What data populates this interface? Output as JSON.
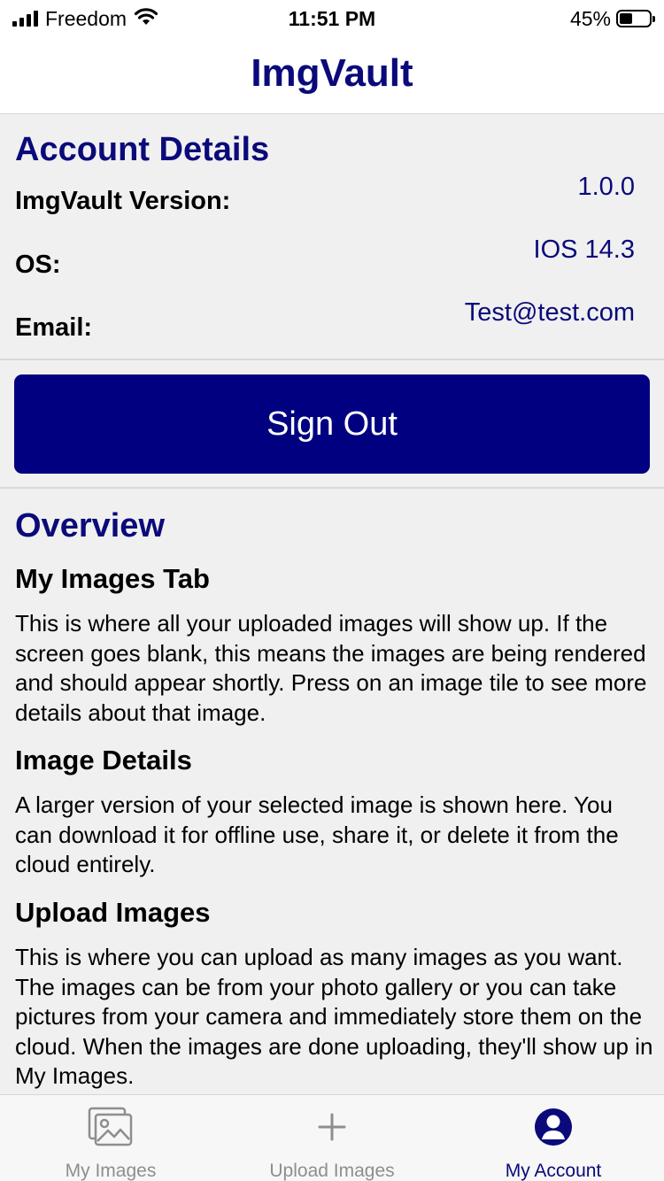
{
  "status_bar": {
    "carrier": "Freedom",
    "time": "11:51 PM",
    "battery_percent": "45%",
    "battery_level": 0.45
  },
  "header": {
    "title": "ImgVault"
  },
  "account": {
    "title": "Account Details",
    "version_label": "ImgVault Version:",
    "version_value": "1.0.0",
    "os_label": "OS:",
    "os_value": "IOS 14.3",
    "email_label": "Email:",
    "email_value": "Test@test.com"
  },
  "sign_out_label": "Sign Out",
  "overview": {
    "title": "Overview",
    "sections": [
      {
        "heading": "My Images Tab",
        "body": "This is where all your uploaded images will show up. If the screen goes blank, this means the images are being rendered and should appear shortly. Press on an image tile to see more details about that image."
      },
      {
        "heading": "Image Details",
        "body": "A larger version of your selected image is shown here. You can download it for offline use, share it, or delete it from the cloud entirely."
      },
      {
        "heading": "Upload Images",
        "body": "This is where you can upload as many images as you want. The images can be from your photo gallery or you can take pictures from your camera and immediately store them on the cloud. When the images are done uploading, they'll show up in My Images."
      }
    ]
  },
  "tabs": [
    {
      "label": "My Images",
      "icon": "images-icon",
      "active": false
    },
    {
      "label": "Upload Images",
      "icon": "plus-icon",
      "active": false
    },
    {
      "label": "My Account",
      "icon": "account-icon",
      "active": true
    }
  ],
  "colors": {
    "accent": "#0a0a7a",
    "button": "#000080",
    "background": "#f0f0f0",
    "inactive_tab": "#8e8e8e"
  }
}
